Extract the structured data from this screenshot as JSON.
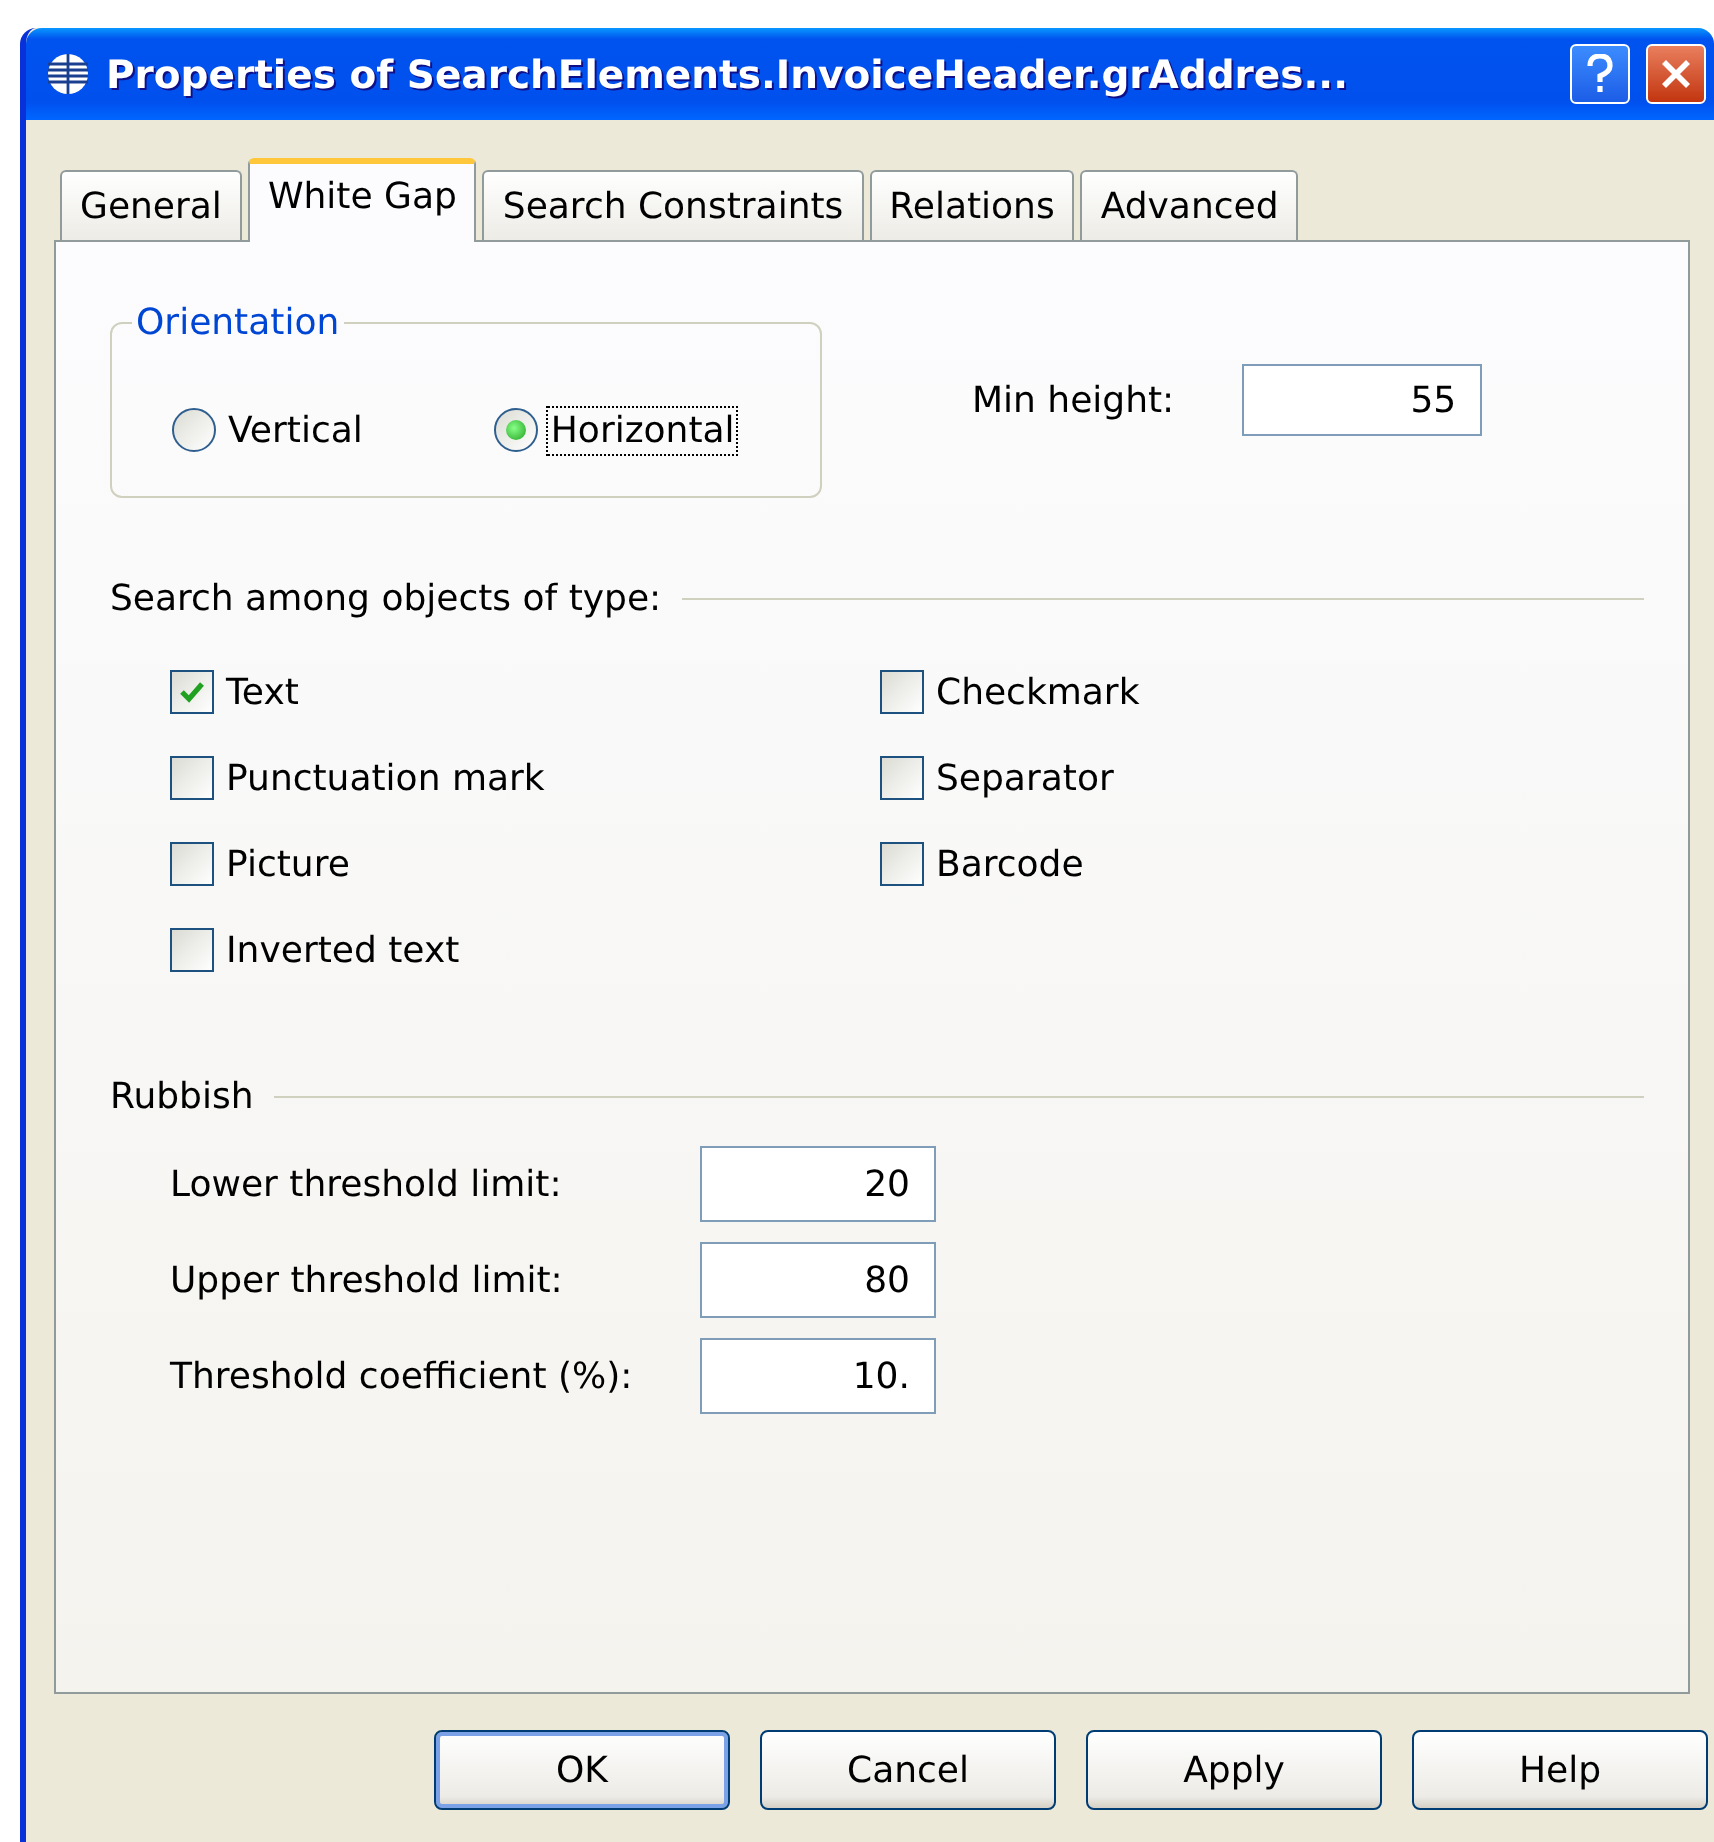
{
  "window": {
    "title": "Properties of SearchElements.InvoiceHeader.grAddres..."
  },
  "tabs": [
    {
      "label": "General",
      "selected": false
    },
    {
      "label": "White Gap",
      "selected": true
    },
    {
      "label": "Search Constraints",
      "selected": false
    },
    {
      "label": "Relations",
      "selected": false
    },
    {
      "label": "Advanced",
      "selected": false
    }
  ],
  "orientation": {
    "legend": "Orientation",
    "options": [
      {
        "label": "Vertical",
        "selected": false
      },
      {
        "label": "Horizontal",
        "selected": true
      }
    ]
  },
  "min_height": {
    "label": "Min height:",
    "value": "55"
  },
  "object_types": {
    "heading": "Search among objects of type:",
    "items": [
      {
        "label": "Text",
        "checked": true
      },
      {
        "label": "Checkmark",
        "checked": false
      },
      {
        "label": "Punctuation mark",
        "checked": false
      },
      {
        "label": "Separator",
        "checked": false
      },
      {
        "label": "Picture",
        "checked": false
      },
      {
        "label": "Barcode",
        "checked": false
      },
      {
        "label": "Inverted text",
        "checked": false
      }
    ]
  },
  "rubbish": {
    "heading": "Rubbish",
    "fields": [
      {
        "label": "Lower threshold limit:",
        "value": "20"
      },
      {
        "label": "Upper threshold limit:",
        "value": "80"
      },
      {
        "label": "Threshold coefficient (%):",
        "value": "10."
      }
    ]
  },
  "buttons": [
    {
      "label": "OK",
      "default": true
    },
    {
      "label": "Cancel",
      "default": false
    },
    {
      "label": "Apply",
      "default": false
    },
    {
      "label": "Help",
      "default": false
    }
  ]
}
